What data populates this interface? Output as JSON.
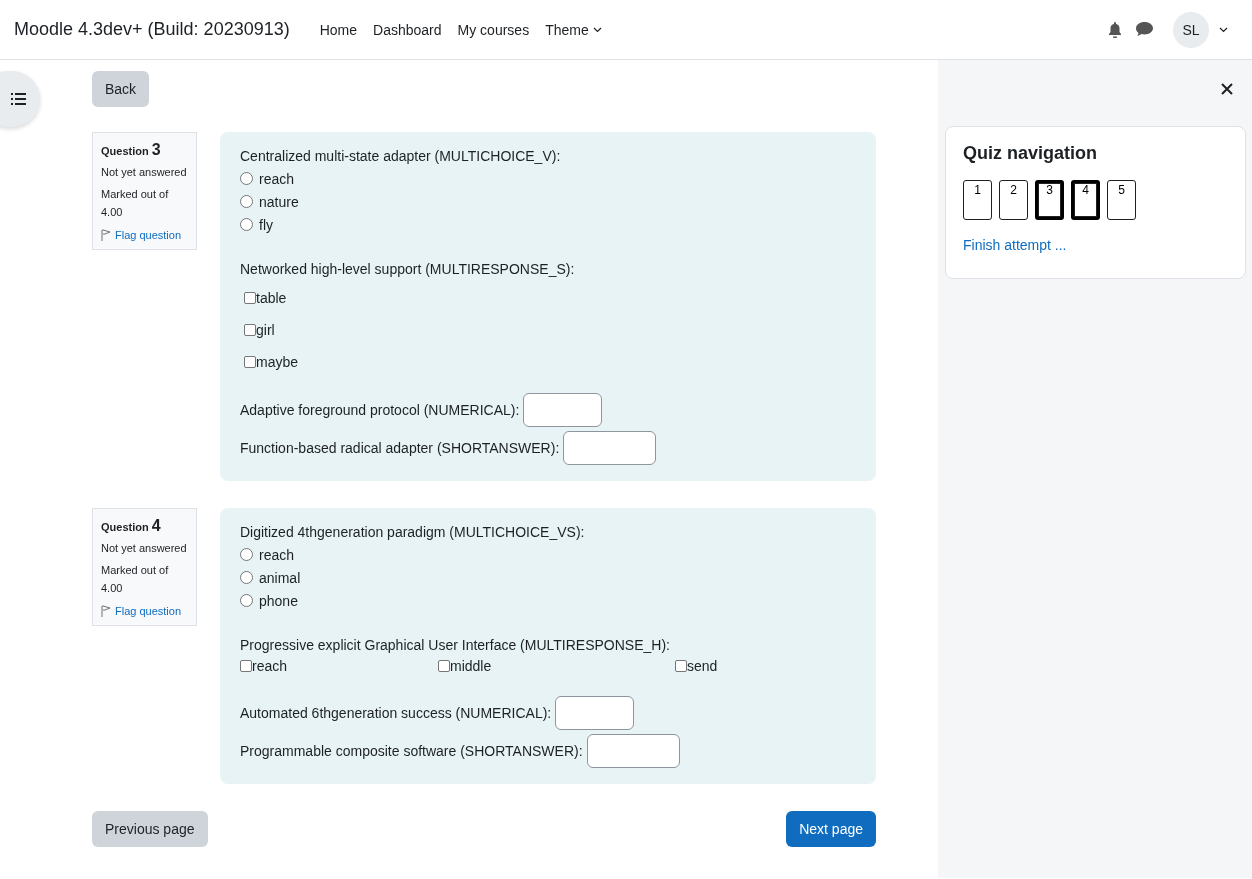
{
  "header": {
    "site_name": "Moodle 4.3dev+ (Build: 20230913)",
    "nav": [
      {
        "label": "Home",
        "dropdown": false
      },
      {
        "label": "Dashboard",
        "dropdown": false
      },
      {
        "label": "My courses",
        "dropdown": false
      },
      {
        "label": "Theme",
        "dropdown": true
      }
    ],
    "avatar": "SL"
  },
  "back_button": "Back",
  "questions": [
    {
      "label": "Question",
      "number": "3",
      "state": "Not yet answered",
      "marks": "Marked out of 4.00",
      "flag": "Flag question",
      "parts": [
        {
          "kind": "radio",
          "prompt": "Centralized multi-state adapter (MULTICHOICE_V):",
          "options": [
            {
              "label": "reach",
              "selected": false
            },
            {
              "label": "nature",
              "selected": false
            },
            {
              "label": "fly",
              "selected": false
            }
          ]
        },
        {
          "kind": "checkbox_list",
          "prompt": "Networked high-level support (MULTIRESPONSE_S):",
          "options": [
            {
              "label": "table",
              "checked": false
            },
            {
              "label": "girl",
              "checked": false
            },
            {
              "label": "maybe",
              "checked": false
            }
          ]
        },
        {
          "kind": "numeric_field",
          "prompt": "Adaptive foreground protocol (NUMERICAL):"
        },
        {
          "kind": "text_field",
          "prompt": "Function-based radical adapter (SHORTANSWER):"
        }
      ]
    },
    {
      "label": "Question",
      "number": "4",
      "state": "Not yet answered",
      "marks": "Marked out of 4.00",
      "flag": "Flag question",
      "parts": [
        {
          "kind": "radio",
          "prompt": "Digitized 4thgeneration paradigm (MULTICHOICE_VS):",
          "options": [
            {
              "label": "reach",
              "selected": false
            },
            {
              "label": "animal",
              "selected": false
            },
            {
              "label": "phone",
              "selected": false
            }
          ]
        },
        {
          "kind": "checkbox_row",
          "prompt": "Progressive explicit Graphical User Interface (MULTIRESPONSE_H):",
          "options": [
            {
              "label": "reach",
              "checked": false
            },
            {
              "label": "middle",
              "checked": false
            },
            {
              "label": "send",
              "checked": false
            }
          ]
        },
        {
          "kind": "numeric_field",
          "prompt": "Automated 6thgeneration success (NUMERICAL):"
        },
        {
          "kind": "text_field",
          "prompt": "Programmable composite software (SHORTANSWER):"
        }
      ]
    }
  ],
  "previous_button": "Previous page",
  "next_button": "Next page",
  "quiz_nav": {
    "title": "Quiz navigation",
    "buttons": [
      {
        "label": "1",
        "selected": false
      },
      {
        "label": "2",
        "selected": false
      },
      {
        "label": "3",
        "selected": true
      },
      {
        "label": "4",
        "selected": true
      },
      {
        "label": "5",
        "selected": false
      }
    ],
    "finish": "Finish attempt ..."
  }
}
